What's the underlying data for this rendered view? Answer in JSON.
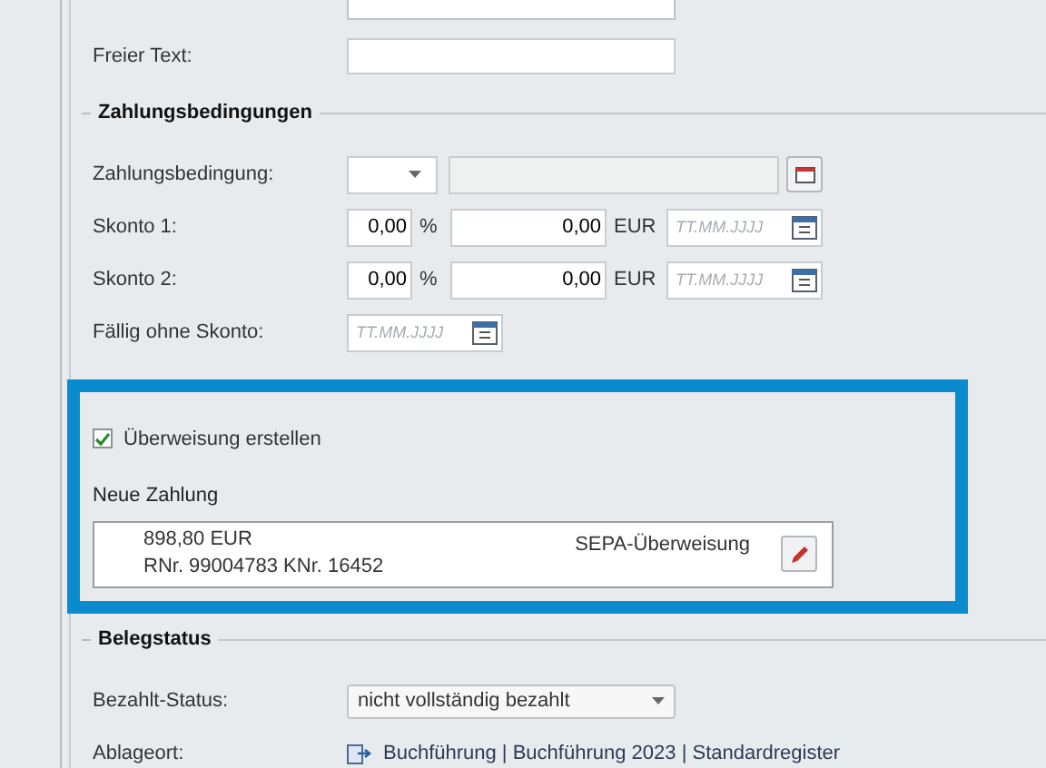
{
  "free_text": {
    "label": "Freier Text:"
  },
  "payment_terms": {
    "heading": "Zahlungsbedingungen",
    "term": {
      "label": "Zahlungsbedingung:"
    },
    "discounts": [
      {
        "label": "Skonto 1:",
        "percent": "0,00",
        "percent_unit": "%",
        "amount": "0,00",
        "currency": "EUR",
        "date_placeholder": "TT.MM.JJJJ"
      },
      {
        "label": "Skonto 2:",
        "percent": "0,00",
        "percent_unit": "%",
        "amount": "0,00",
        "currency": "EUR",
        "date_placeholder": "TT.MM.JJJJ"
      }
    ],
    "due": {
      "label": "Fällig ohne Skonto:",
      "date_placeholder": "TT.MM.JJJJ"
    }
  },
  "payment": {
    "create_transfer": {
      "label": "Überweisung erstellen",
      "checked": true
    },
    "new_payment_label": "Neue Zahlung",
    "entry": {
      "amount": "898,80 EUR",
      "reference": "RNr. 99004783 KNr. 16452",
      "method": "SEPA-Überweisung"
    }
  },
  "document_status": {
    "heading": "Belegstatus",
    "paid_status": {
      "label": "Bezahlt-Status:",
      "value": "nicht vollständig bezahlt"
    },
    "location": {
      "label": "Ablageort:",
      "value": "Buchführung | Buchführung 2023 | Standardregister"
    }
  }
}
